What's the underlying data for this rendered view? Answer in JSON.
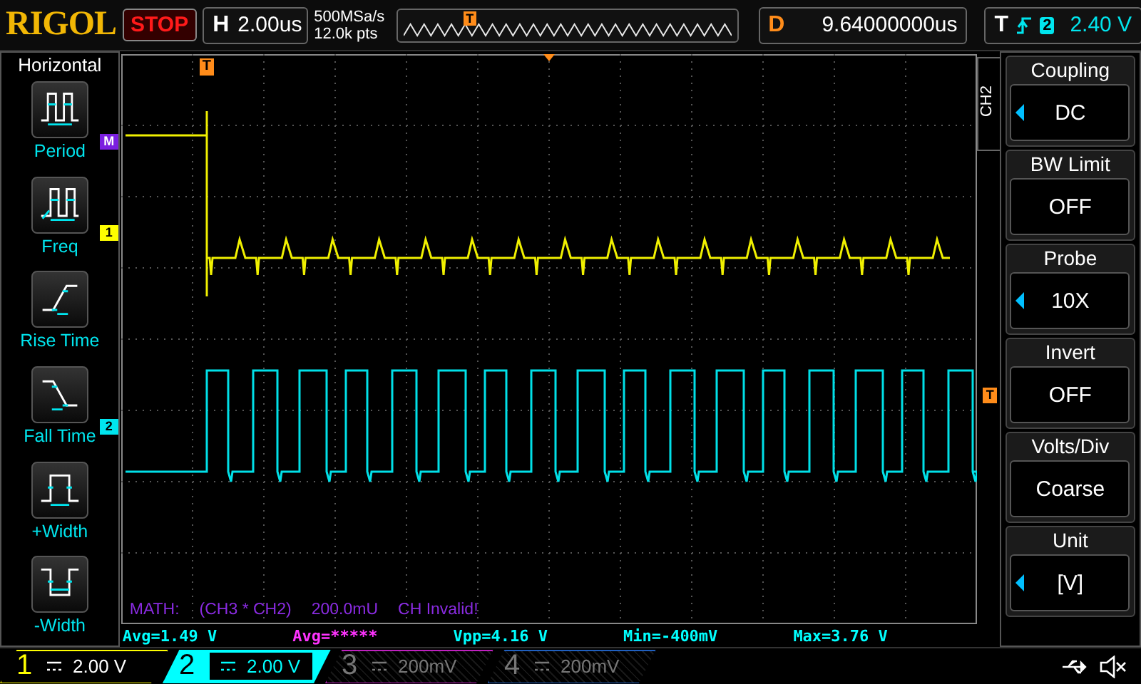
{
  "top_bar": {
    "logo": "RIGOL",
    "run_state": "STOP",
    "timebase": {
      "label": "H",
      "value": "2.00us"
    },
    "sample_rate": "500MSa/s",
    "memory_depth": "12.0k pts",
    "memory_marker": "T",
    "delay": {
      "label": "D",
      "value": "9.64000000us"
    },
    "trigger": {
      "label": "T",
      "source": "2",
      "level": "2.40 V"
    }
  },
  "left_menu": {
    "title": "Horizontal",
    "items": [
      {
        "label": "Period",
        "kind": "period"
      },
      {
        "label": "Freq",
        "kind": "freq"
      },
      {
        "label": "Rise Time",
        "kind": "rise"
      },
      {
        "label": "Fall Time",
        "kind": "fall"
      },
      {
        "label": "+Width",
        "kind": "pwidth"
      },
      {
        "label": "-Width",
        "kind": "nwidth"
      }
    ]
  },
  "scope": {
    "trigger_marker": "T",
    "trigger_level_marker": "T",
    "channel_markers": [
      {
        "label": "M",
        "color": "#7b1fe0"
      },
      {
        "label": "1",
        "color": "#ffff00"
      },
      {
        "label": "2",
        "color": "#00e5ee"
      }
    ],
    "math_line": [
      "MATH:",
      "(CH3 * CH2)",
      "200.0mU",
      "CH Invalid!"
    ]
  },
  "measurements": [
    {
      "text": "Avg=1.49 V",
      "color": "#00ffff"
    },
    {
      "text": "Avg=*****",
      "color": "#ff33ff"
    },
    {
      "text": "Vpp=4.16 V",
      "color": "#00ffff"
    },
    {
      "text": "Min=-400mV",
      "color": "#00ffff"
    },
    {
      "text": "Max=3.76 V",
      "color": "#00ffff"
    }
  ],
  "right_menu": {
    "tab": "CH2",
    "items": [
      {
        "title": "Coupling",
        "value": "DC",
        "has_options": true
      },
      {
        "title": "BW Limit",
        "value": "OFF",
        "has_options": false
      },
      {
        "title": "Probe",
        "value": "10X",
        "has_options": true
      },
      {
        "title": "Invert",
        "value": "OFF",
        "has_options": false
      },
      {
        "title": "Volts/Div",
        "value": "Coarse",
        "has_options": false
      },
      {
        "title": "Unit",
        "value": "[V]",
        "has_options": true
      }
    ]
  },
  "channels": [
    {
      "number": "1",
      "scale": "2.00 V",
      "color": "#ffff00",
      "selected": false,
      "on": true
    },
    {
      "number": "2",
      "scale": "2.00 V",
      "color": "#00ffff",
      "selected": true,
      "on": true
    },
    {
      "number": "3",
      "scale": "200mV",
      "color": "#c020c0",
      "selected": false,
      "on": false
    },
    {
      "number": "4",
      "scale": "200mV",
      "color": "#2060c0",
      "selected": false,
      "on": false
    }
  ]
}
